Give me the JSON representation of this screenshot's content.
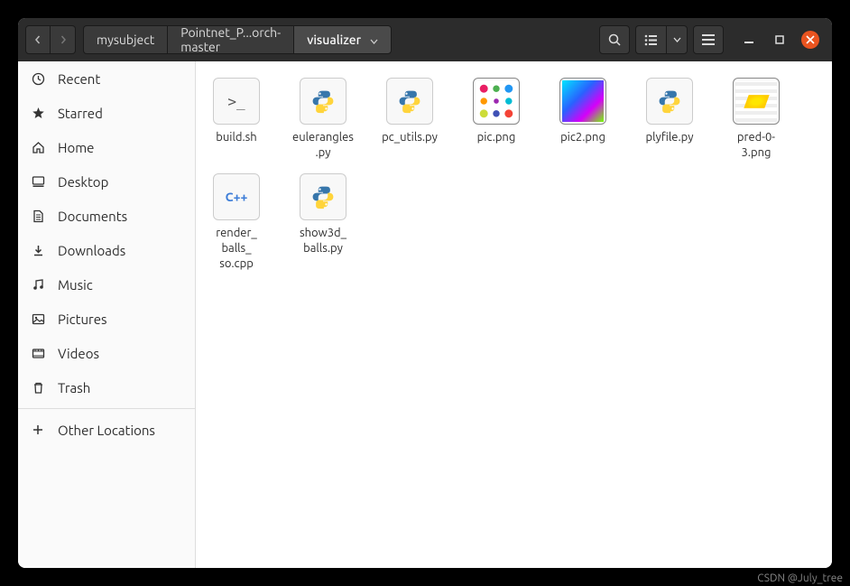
{
  "path": {
    "seg1": "mysubject",
    "seg2": "Pointnet_P...orch-master",
    "seg3": "visualizer"
  },
  "sidebar": [
    {
      "icon": "clock",
      "label": "Recent"
    },
    {
      "icon": "star",
      "label": "Starred"
    },
    {
      "icon": "home",
      "label": "Home"
    },
    {
      "icon": "desktop",
      "label": "Desktop"
    },
    {
      "icon": "documents",
      "label": "Documents"
    },
    {
      "icon": "downloads",
      "label": "Downloads"
    },
    {
      "icon": "music",
      "label": "Music"
    },
    {
      "icon": "pictures",
      "label": "Pictures"
    },
    {
      "icon": "videos",
      "label": "Videos"
    },
    {
      "icon": "trash",
      "label": "Trash"
    }
  ],
  "other_locations": "Other Locations",
  "files": [
    {
      "name": "build.sh",
      "kind": "sh",
      "badge": ">_"
    },
    {
      "name": "eulerangles.py",
      "kind": "py"
    },
    {
      "name": "pc_utils.py",
      "kind": "py"
    },
    {
      "name": "pic.png",
      "kind": "img",
      "thumb": "thumb1"
    },
    {
      "name": "pic2.png",
      "kind": "img",
      "thumb": "thumb2"
    },
    {
      "name": "plyfile.py",
      "kind": "py"
    },
    {
      "name": "pred-0-3.png",
      "kind": "img",
      "thumb": "thumb3"
    },
    {
      "name": "render_balls_so.cpp",
      "kind": "cpp",
      "badge": "C++"
    },
    {
      "name": "show3d_balls.py",
      "kind": "py"
    }
  ],
  "watermark": "CSDN @July_tree"
}
